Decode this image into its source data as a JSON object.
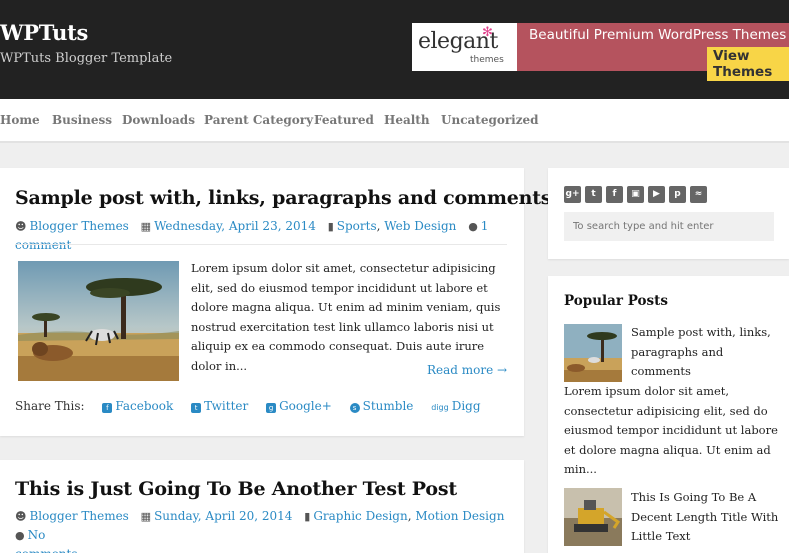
{
  "site": {
    "title": "WPTuts",
    "description": "WPTuts Blogger Template"
  },
  "banner": {
    "logo_word": "elegant",
    "logo_sub": "themes",
    "headline": "Beautiful Premium WordPress Themes",
    "cta": "View Themes",
    "colors": {
      "panel": "#b5535e",
      "cta": "#f8d547"
    }
  },
  "nav": {
    "items": [
      {
        "label": "Home"
      },
      {
        "label": "Business"
      },
      {
        "label": "Downloads"
      },
      {
        "label": "Parent Category"
      },
      {
        "label": "Featured"
      },
      {
        "label": "Health"
      },
      {
        "label": "Uncategorized"
      }
    ]
  },
  "posts": [
    {
      "title": "Sample post with, links, paragraphs and comments",
      "author": "Blogger Themes",
      "date": "Wednesday, April 23, 2014",
      "categories": [
        "Sports",
        "Web Design"
      ],
      "comments": "1 comment",
      "excerpt": "Lorem ipsum dolor sit amet, consectetur adipisicing elit, sed do eiusmod tempor incididunt ut labore et dolore magna aliqua. Ut enim ad minim veniam, quis nostrud exercitation test link ullamco laboris nisi ut aliquip ex ea commodo consequat. Duis aute irure dolor in...",
      "read_more": "Read more →",
      "share_label": "Share This:",
      "share": [
        {
          "label": "Facebook",
          "icon": "facebook-icon"
        },
        {
          "label": "Twitter",
          "icon": "twitter-icon"
        },
        {
          "label": "Google+",
          "icon": "google-plus-icon"
        },
        {
          "label": "Stumble",
          "icon": "stumbleupon-icon"
        },
        {
          "label": "Digg",
          "icon": "digg-icon"
        }
      ]
    },
    {
      "title": "This is Just Going To Be Another Test Post",
      "author": "Blogger Themes",
      "date": "Sunday, April 20, 2014",
      "categories": [
        "Graphic Design",
        "Motion Design"
      ],
      "comments_part1": "No",
      "comments_part2": "comments"
    }
  ],
  "sidebar": {
    "social_icons": [
      "google-plus-icon",
      "twitter-icon",
      "facebook-icon",
      "instagram-icon",
      "youtube-icon",
      "pinterest-icon",
      "rss-icon"
    ],
    "search_placeholder": "To search type and hit enter",
    "popular_title": "Popular Posts",
    "popular": [
      {
        "title": "Sample post with, links, paragraphs and comments",
        "excerpt": "Lorem ipsum dolor sit amet, consectetur adipisicing elit, sed do eiusmod tempor incididunt ut labore et dolore magna aliqua. Ut enim ad min..."
      },
      {
        "title": "This Is Going To Be A Decent Length Title With Little Text"
      }
    ]
  },
  "colors": {
    "link": "#2a8ac4",
    "header": "#222222"
  }
}
